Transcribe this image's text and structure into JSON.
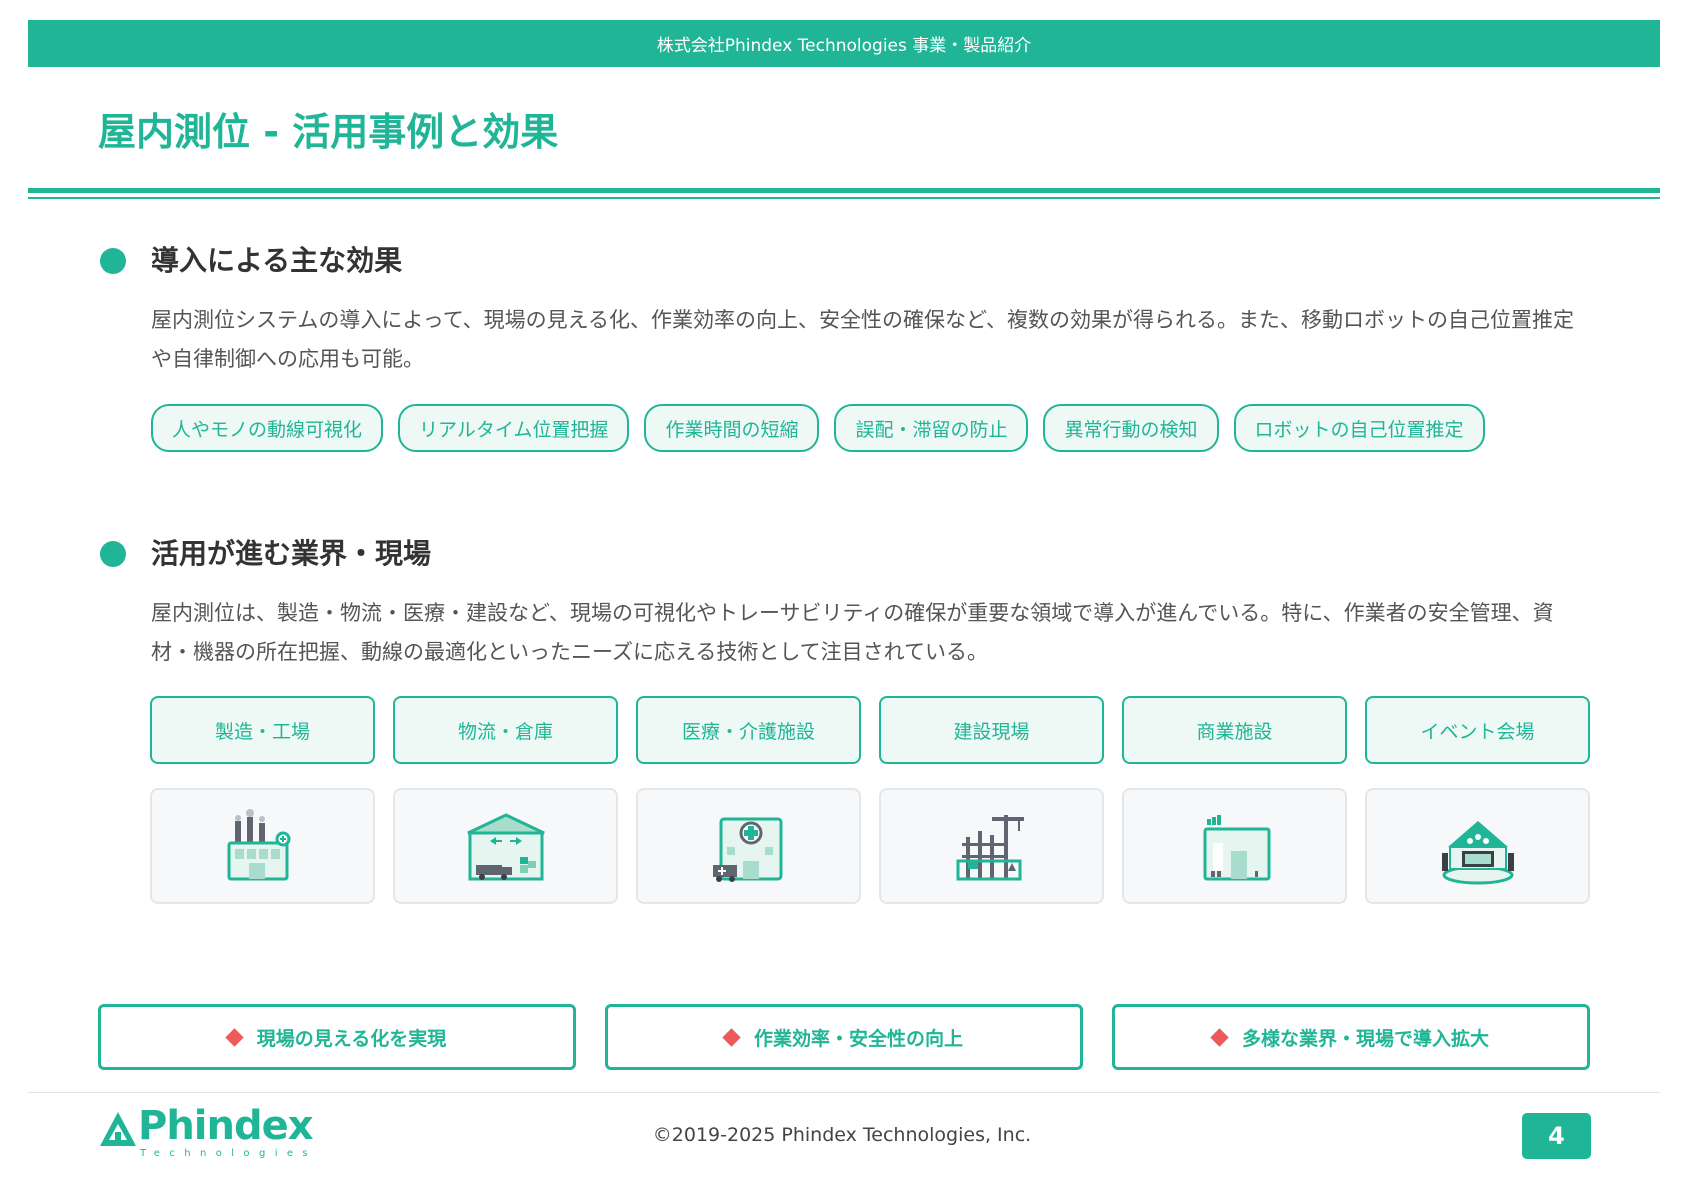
{
  "header": {
    "banner": "株式会社Phindex Technologies 事業・製品紹介"
  },
  "title": "屋内測位 - 活用事例と効果",
  "section1": {
    "heading": "導入による主な効果",
    "body": "屋内測位システムの導入によって、現場の見える化、作業効率の向上、安全性の確保など、複数の効果が得られる。また、移動ロボットの自己位置推定や自律制御への応用も可能。",
    "tags": [
      "人やモノの動線可視化",
      "リアルタイム位置把握",
      "作業時間の短縮",
      "誤配・滞留の防止",
      "異常行動の検知",
      "ロボットの自己位置推定"
    ]
  },
  "section2": {
    "heading": "活用が進む業界・現場",
    "body": "屋内測位は、製造・物流・医療・建設など、現場の可視化やトレーサビリティの確保が重要な領域で導入が進んでいる。特に、作業者の安全管理、資材・機器の所在把握、動線の最適化といったニーズに応える技術として注目されている。",
    "industries": [
      {
        "label": "製造・工場",
        "icon": "factory-icon"
      },
      {
        "label": "物流・倉庫",
        "icon": "warehouse-icon"
      },
      {
        "label": "医療・介護施設",
        "icon": "hospital-icon"
      },
      {
        "label": "建設現場",
        "icon": "construction-icon"
      },
      {
        "label": "商業施設",
        "icon": "store-icon"
      },
      {
        "label": "イベント会場",
        "icon": "event-venue-icon"
      }
    ]
  },
  "outcomes": [
    "現場の見える化を実現",
    "作業効率・安全性の向上",
    "多様な業界・現場で導入拡大"
  ],
  "footer": {
    "logo_text": "Phindex",
    "logo_sub": "Technologies",
    "copyright": "©2019-2025 Phindex Technologies, Inc.",
    "page_number": "4"
  },
  "colors": {
    "accent": "#20b597",
    "accent_light": "#eef9f5",
    "diamond": "#ec5a5a",
    "icon_gray": "#5f6670"
  }
}
